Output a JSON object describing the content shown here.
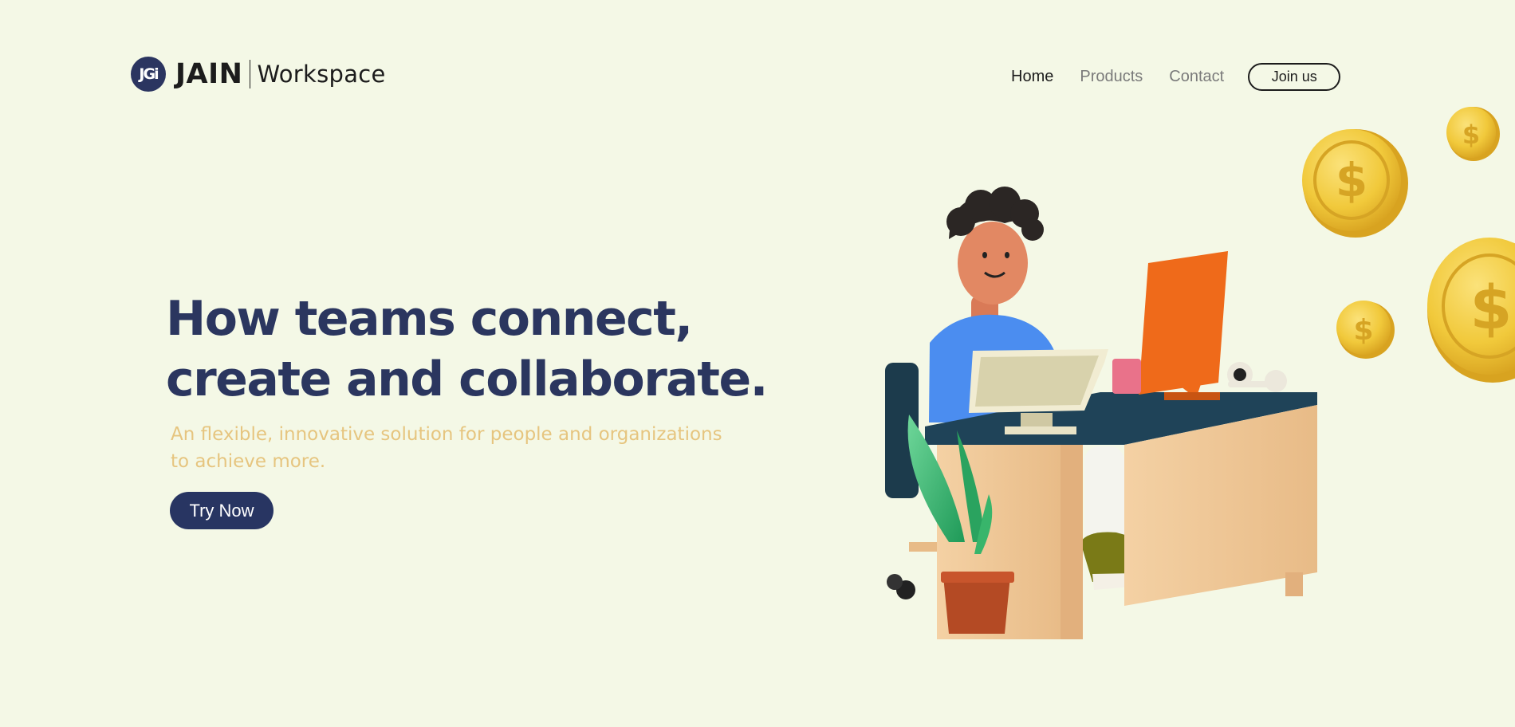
{
  "brand": {
    "badge": "JGi",
    "name": "JAIN",
    "sub": "Workspace"
  },
  "nav": {
    "items": [
      {
        "label": "Home",
        "active": true
      },
      {
        "label": "Products",
        "active": false
      },
      {
        "label": "Contact",
        "active": false
      }
    ],
    "join_label": "Join us"
  },
  "hero": {
    "title_line1": "How teams connect,",
    "title_line2": "create and collaborate.",
    "sub_line1": "An flexible, innovative solution for people and organizations",
    "sub_line2": "to achieve more.",
    "cta_label": "Try Now"
  },
  "colors": {
    "background": "#f4f8e6",
    "primary": "#283562",
    "subtitle": "#e6c57f",
    "coin": "#f1c93b"
  },
  "icons": {
    "coins": "dollar-coin-icon",
    "illustration": "person-at-desk-illustration"
  }
}
